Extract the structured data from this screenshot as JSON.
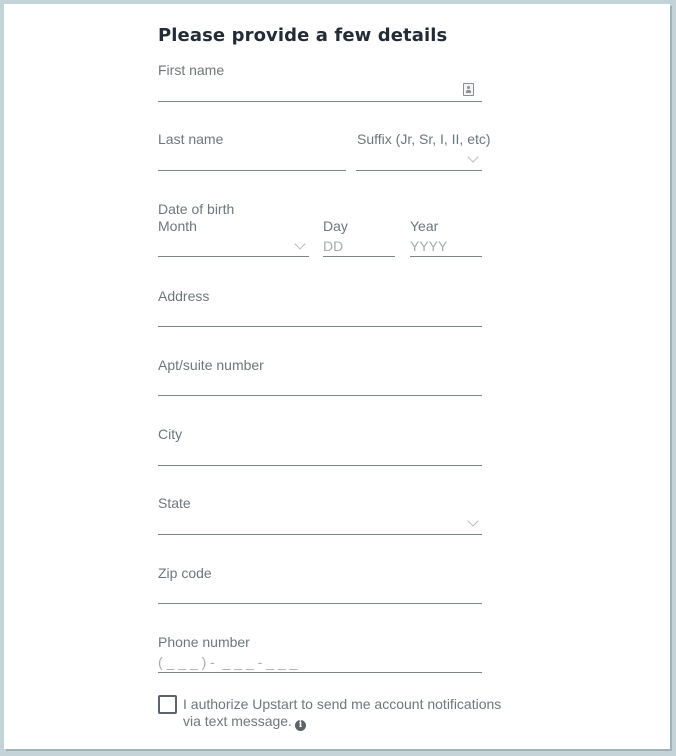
{
  "form": {
    "title": "Please provide a few details",
    "first_name": {
      "label": "First name",
      "value": "",
      "icon": "contact-card-icon"
    },
    "last_name": {
      "label": "Last name",
      "value": ""
    },
    "suffix": {
      "label": "Suffix (Jr, Sr, I, II, etc)",
      "selected": ""
    },
    "dob": {
      "label": "Date of birth",
      "month": {
        "label": "Month",
        "selected": ""
      },
      "day": {
        "label": "Day",
        "placeholder": "DD",
        "value": ""
      },
      "year": {
        "label": "Year",
        "placeholder": "YYYY",
        "value": ""
      }
    },
    "address": {
      "label": "Address",
      "value": ""
    },
    "apt": {
      "label": "Apt/suite number",
      "value": ""
    },
    "city": {
      "label": "City",
      "value": ""
    },
    "state": {
      "label": "State",
      "selected": ""
    },
    "zip": {
      "label": "Zip code",
      "value": ""
    },
    "phone": {
      "label": "Phone number",
      "placeholder": "( _ _ _ ) -  _ _ _ - _ _ _",
      "value": ""
    },
    "sms_consent": {
      "checked": false,
      "text": "I authorize Upstart to send me account notifications via text message.",
      "info_icon": "i"
    }
  }
}
